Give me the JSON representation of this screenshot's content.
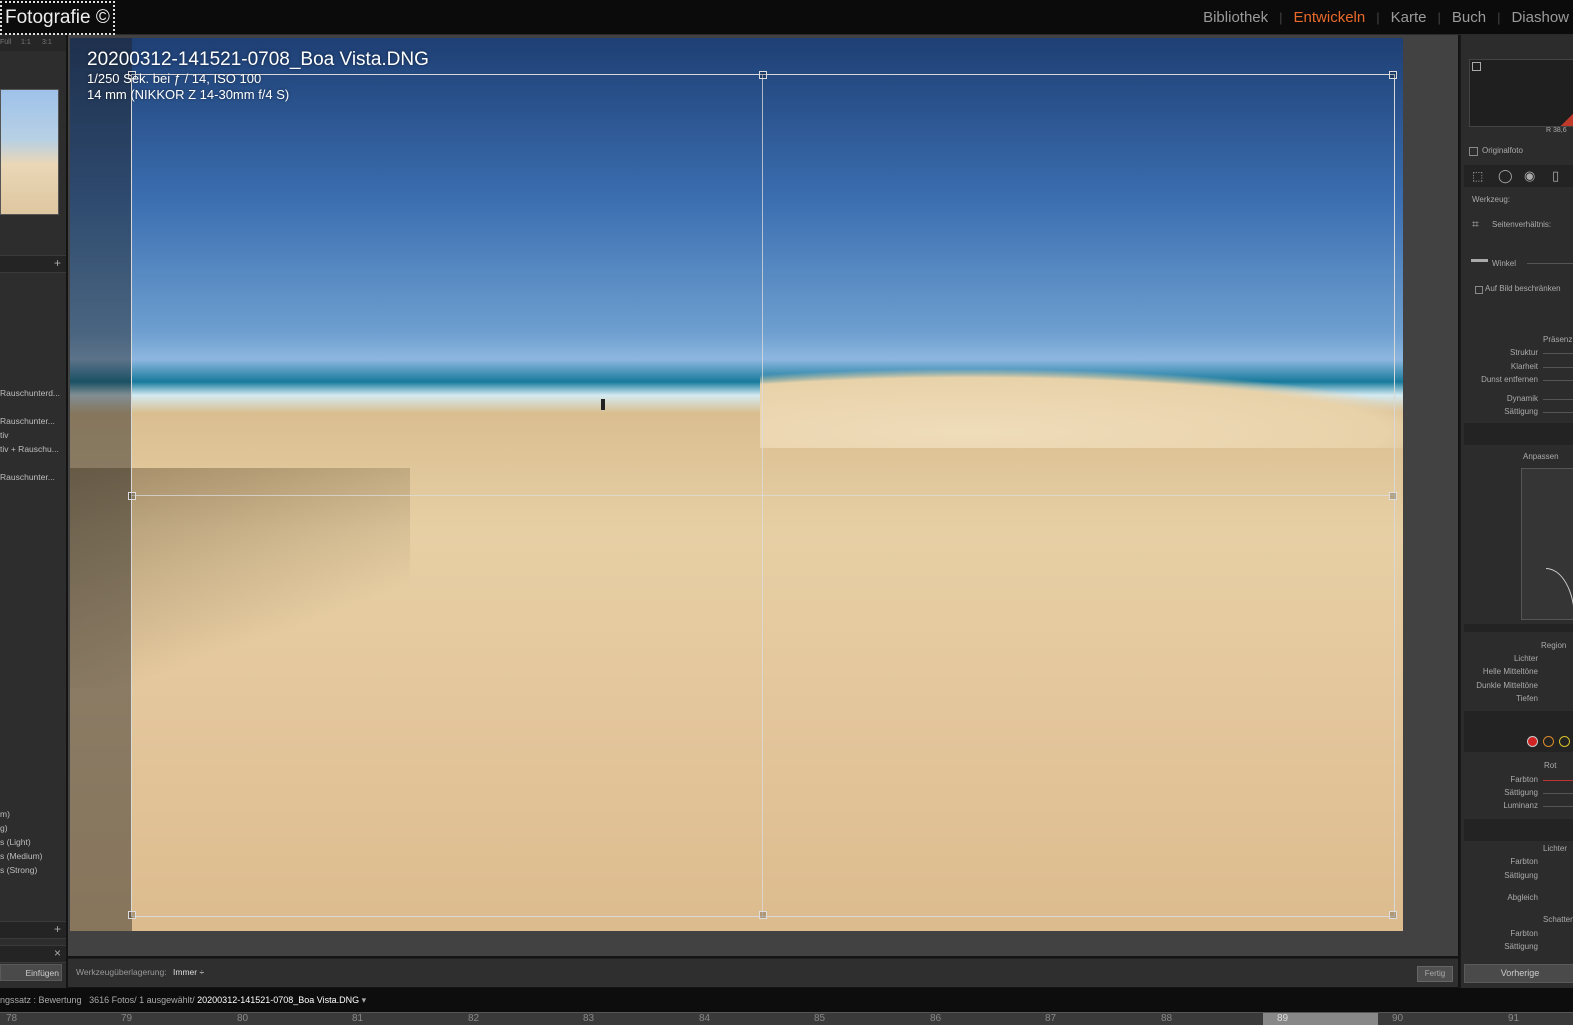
{
  "app": {
    "logo": "Fotografie ©"
  },
  "modules": [
    {
      "label": "Bibliothek",
      "active": false
    },
    {
      "label": "Entwickeln",
      "active": true
    },
    {
      "label": "Karte",
      "active": false
    },
    {
      "label": "Buch",
      "active": false
    },
    {
      "label": "Diashow",
      "active": false
    }
  ],
  "left_panel": {
    "nav_zoom": [
      "Füll",
      "1:1",
      "3:1"
    ],
    "presets": [
      "Rauschunterd...",
      "Rauschunter...",
      "tiv",
      "tiv + Rauschu...",
      "Rauschunter..."
    ],
    "presets2": [
      "m)",
      "g)",
      "s (Light)",
      "s (Medium)",
      "s (Strong)"
    ],
    "paste_button": "Einfügen"
  },
  "photo": {
    "filename": "20200312-141521-0708_Boa Vista.DNG",
    "exposure": "1/250 Sek. bei ƒ / 14, ISO 100",
    "lens": "14 mm (NIKKOR Z 14-30mm f/4 S)"
  },
  "toolbar": {
    "overlay_label": "Werkzeugüberlagerung:",
    "overlay_value": "Immer ÷",
    "done_label": "Fertig"
  },
  "right_panel": {
    "histogram_value": "R 38,6",
    "original_label": "Originalfoto",
    "tool_label": "Werkzeug:",
    "aspect_label": "Seitenverhältnis:",
    "angle_label": "Winkel",
    "constrain_label": "Auf Bild beschränken",
    "presence_header": "Präsenz",
    "presence_items": [
      "Struktur",
      "Klarheit",
      "Dunst entfernen",
      "Dynamik",
      "Sättigung"
    ],
    "curve_header": "Anpassen",
    "region_header": "Region",
    "region_items": [
      "Lichter",
      "Helle Mitteltöne",
      "Dunkle Mitteltöne",
      "Tiefen"
    ],
    "color_header": "Rot",
    "color_items": [
      "Farbton",
      "Sättigung",
      "Luminanz"
    ],
    "split_header": "Lichter",
    "split_items": [
      "Farbton",
      "Sättigung"
    ],
    "balance_label": "Abgleich",
    "shadows_header": "Schatten",
    "shadows_items": [
      "Farbton",
      "Sättigung"
    ],
    "prev_button": "Vorherige"
  },
  "status": {
    "source": "ngssatz : Bewertung",
    "count": "3616 Fotos/ 1 ausgewählt/",
    "selected": "20200312-141521-0708_Boa Vista.DNG"
  },
  "filmstrip": {
    "numbers": [
      "78",
      "79",
      "80",
      "81",
      "82",
      "83",
      "84",
      "85",
      "86",
      "87",
      "88",
      "89",
      "90",
      "91"
    ]
  }
}
